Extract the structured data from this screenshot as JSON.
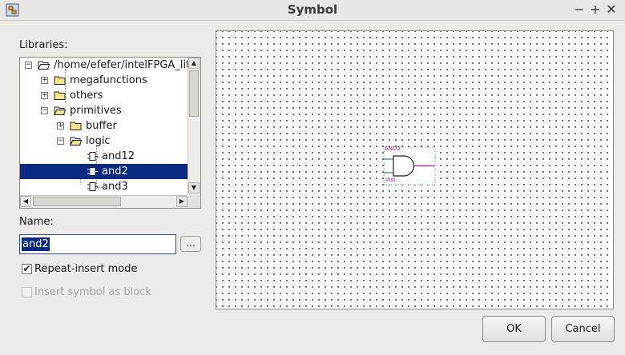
{
  "window": {
    "title": "Symbol"
  },
  "libraries": {
    "label": "Libraries:",
    "tree": [
      {
        "label": "/home/efefer/intelFPGA_lite",
        "type": "folder"
      },
      {
        "label": "megafunctions",
        "type": "folder"
      },
      {
        "label": "others",
        "type": "folder"
      },
      {
        "label": "primitives",
        "type": "folder"
      },
      {
        "label": "buffer",
        "type": "folder"
      },
      {
        "label": "logic",
        "type": "folder"
      },
      {
        "label": "and12",
        "type": "symbol"
      },
      {
        "label": "and2",
        "type": "symbol",
        "selected": true
      },
      {
        "label": "and3",
        "type": "symbol"
      }
    ]
  },
  "name": {
    "label": "Name:",
    "value": "and2",
    "browse_label": "..."
  },
  "options": {
    "repeat_insert": {
      "label": "Repeat-insert mode",
      "checked": true
    },
    "insert_block": {
      "label": "Insert symbol as block",
      "checked": false,
      "disabled": true
    }
  },
  "preview": {
    "symbol_name": "AND2",
    "instance": "inst"
  },
  "buttons": {
    "ok": "OK",
    "cancel": "Cancel"
  },
  "colors": {
    "selection": "#0a2a82",
    "symbol_label": "#8b1a8b",
    "pin": "#2b8a8a"
  }
}
